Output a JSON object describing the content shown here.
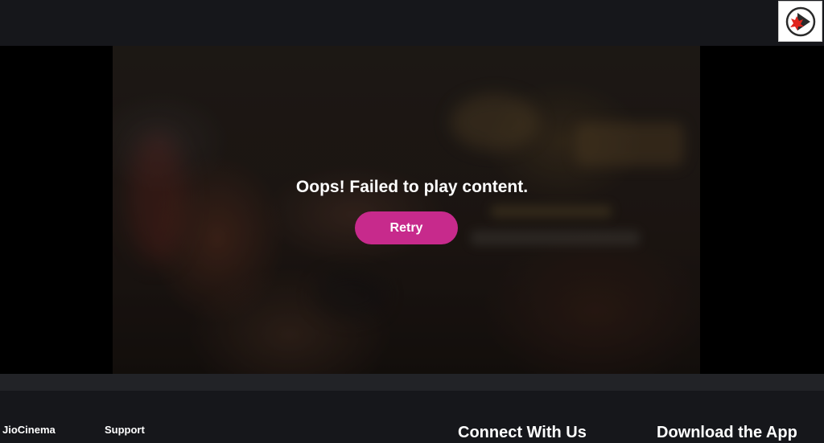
{
  "player": {
    "error_message": "Oops! Failed to play content.",
    "retry_label": "Retry"
  },
  "footer": {
    "brand_link": "JioCinema",
    "support_link": "Support",
    "connect_heading": "Connect With Us",
    "download_heading": "Download the App"
  },
  "colors": {
    "accent": "#c72a8c",
    "background": "#16171b"
  },
  "icons": {
    "corner_logo": "red-play-logo-icon"
  }
}
